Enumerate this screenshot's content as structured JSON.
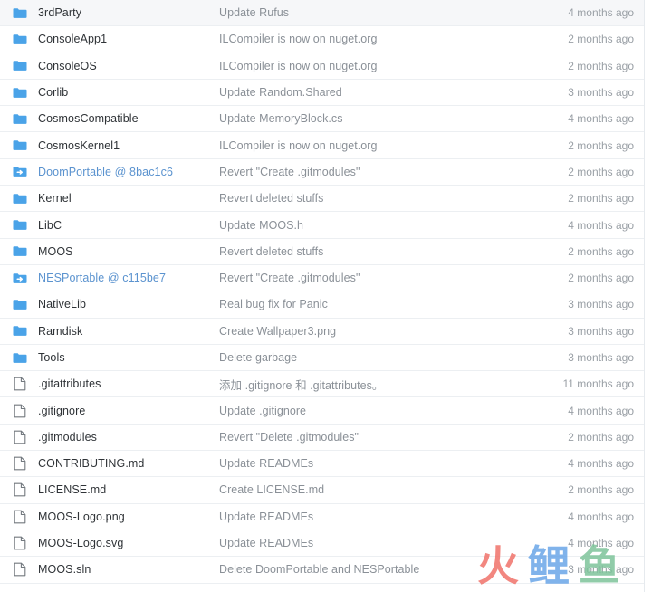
{
  "view": {
    "kind": "repository-file-listing",
    "columns": [
      "name",
      "last_commit_message",
      "last_updated"
    ]
  },
  "colors": {
    "folder_icon": "#4aa3e8",
    "file_icon_outline": "#73797f",
    "link_text": "#5b93cf",
    "name_text": "#2f3337",
    "message_text": "#8a9097",
    "time_text": "#9aa0a6",
    "row_border": "#eceff2",
    "row_shaded_bg": "#f6f7f9"
  },
  "watermark": {
    "characters": [
      {
        "glyph": "火",
        "color": "#f0736b"
      },
      {
        "glyph": "鲤",
        "color": "#6aa6e8"
      },
      {
        "glyph": "鱼",
        "color": "#7ec49b"
      }
    ]
  },
  "rows": [
    {
      "icon": "folder-icon",
      "type": "folder",
      "name": "3rdParty",
      "is_link": false,
      "message": "Update Rufus",
      "time": "4 months ago",
      "shaded": true
    },
    {
      "icon": "folder-icon",
      "type": "folder",
      "name": "ConsoleApp1",
      "is_link": false,
      "message": "ILCompiler is now on nuget.org",
      "time": "2 months ago",
      "shaded": false
    },
    {
      "icon": "folder-icon",
      "type": "folder",
      "name": "ConsoleOS",
      "is_link": false,
      "message": "ILCompiler is now on nuget.org",
      "time": "2 months ago",
      "shaded": false
    },
    {
      "icon": "folder-icon",
      "type": "folder",
      "name": "Corlib",
      "is_link": false,
      "message": "Update Random.Shared",
      "time": "3 months ago",
      "shaded": false
    },
    {
      "icon": "folder-icon",
      "type": "folder",
      "name": "CosmosCompatible",
      "is_link": false,
      "message": "Update MemoryBlock.cs",
      "time": "4 months ago",
      "shaded": false
    },
    {
      "icon": "folder-icon",
      "type": "folder",
      "name": "CosmosKernel1",
      "is_link": false,
      "message": "ILCompiler is now on nuget.org",
      "time": "2 months ago",
      "shaded": false
    },
    {
      "icon": "submodule-icon",
      "type": "submodule",
      "name": "DoomPortable @ 8bac1c6",
      "is_link": true,
      "message": "Revert \"Create .gitmodules\"",
      "time": "2 months ago",
      "shaded": false
    },
    {
      "icon": "folder-icon",
      "type": "folder",
      "name": "Kernel",
      "is_link": false,
      "message": "Revert deleted stuffs",
      "time": "2 months ago",
      "shaded": false
    },
    {
      "icon": "folder-icon",
      "type": "folder",
      "name": "LibC",
      "is_link": false,
      "message": "Update MOOS.h",
      "time": "4 months ago",
      "shaded": false
    },
    {
      "icon": "folder-icon",
      "type": "folder",
      "name": "MOOS",
      "is_link": false,
      "message": "Revert deleted stuffs",
      "time": "2 months ago",
      "shaded": false
    },
    {
      "icon": "submodule-icon",
      "type": "submodule",
      "name": "NESPortable @ c115be7",
      "is_link": true,
      "message": "Revert \"Create .gitmodules\"",
      "time": "2 months ago",
      "shaded": false
    },
    {
      "icon": "folder-icon",
      "type": "folder",
      "name": "NativeLib",
      "is_link": false,
      "message": "Real bug fix for Panic",
      "time": "3 months ago",
      "shaded": false
    },
    {
      "icon": "folder-icon",
      "type": "folder",
      "name": "Ramdisk",
      "is_link": false,
      "message": "Create Wallpaper3.png",
      "time": "3 months ago",
      "shaded": false
    },
    {
      "icon": "folder-icon",
      "type": "folder",
      "name": "Tools",
      "is_link": false,
      "message": "Delete garbage",
      "time": "3 months ago",
      "shaded": false
    },
    {
      "icon": "file-icon",
      "type": "file",
      "name": ".gitattributes",
      "is_link": false,
      "message": "添加 .gitignore 和 .gitattributes。",
      "time": "11 months ago",
      "shaded": false
    },
    {
      "icon": "file-icon",
      "type": "file",
      "name": ".gitignore",
      "is_link": false,
      "message": "Update .gitignore",
      "time": "4 months ago",
      "shaded": false
    },
    {
      "icon": "file-icon",
      "type": "file",
      "name": ".gitmodules",
      "is_link": false,
      "message": "Revert \"Delete .gitmodules\"",
      "time": "2 months ago",
      "shaded": false
    },
    {
      "icon": "file-icon",
      "type": "file",
      "name": "CONTRIBUTING.md",
      "is_link": false,
      "message": "Update READMEs",
      "time": "4 months ago",
      "shaded": false
    },
    {
      "icon": "file-icon",
      "type": "file",
      "name": "LICENSE.md",
      "is_link": false,
      "message": "Create LICENSE.md",
      "time": "2 months ago",
      "shaded": false
    },
    {
      "icon": "file-icon",
      "type": "file",
      "name": "MOOS-Logo.png",
      "is_link": false,
      "message": "Update READMEs",
      "time": "4 months ago",
      "shaded": false
    },
    {
      "icon": "file-icon",
      "type": "file",
      "name": "MOOS-Logo.svg",
      "is_link": false,
      "message": "Update READMEs",
      "time": "4 months ago",
      "shaded": false
    },
    {
      "icon": "file-icon",
      "type": "file",
      "name": "MOOS.sln",
      "is_link": false,
      "message": "Delete DoomPortable and NESPortable",
      "time": "3 months ago",
      "shaded": false
    }
  ]
}
